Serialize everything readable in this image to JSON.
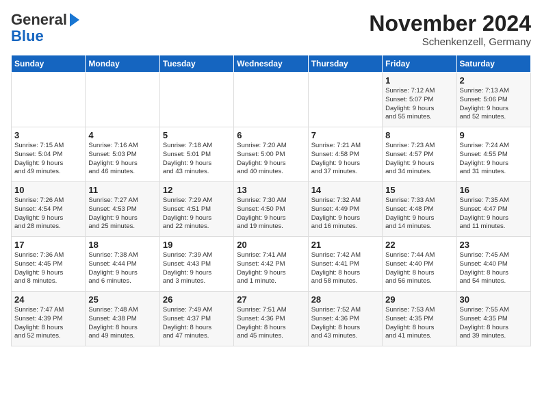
{
  "header": {
    "logo_line1": "General",
    "logo_line2": "Blue",
    "title": "November 2024",
    "subtitle": "Schenkenzell, Germany"
  },
  "weekdays": [
    "Sunday",
    "Monday",
    "Tuesday",
    "Wednesday",
    "Thursday",
    "Friday",
    "Saturday"
  ],
  "weeks": [
    [
      {
        "day": "",
        "info": ""
      },
      {
        "day": "",
        "info": ""
      },
      {
        "day": "",
        "info": ""
      },
      {
        "day": "",
        "info": ""
      },
      {
        "day": "",
        "info": ""
      },
      {
        "day": "1",
        "info": "Sunrise: 7:12 AM\nSunset: 5:07 PM\nDaylight: 9 hours\nand 55 minutes."
      },
      {
        "day": "2",
        "info": "Sunrise: 7:13 AM\nSunset: 5:06 PM\nDaylight: 9 hours\nand 52 minutes."
      }
    ],
    [
      {
        "day": "3",
        "info": "Sunrise: 7:15 AM\nSunset: 5:04 PM\nDaylight: 9 hours\nand 49 minutes."
      },
      {
        "day": "4",
        "info": "Sunrise: 7:16 AM\nSunset: 5:03 PM\nDaylight: 9 hours\nand 46 minutes."
      },
      {
        "day": "5",
        "info": "Sunrise: 7:18 AM\nSunset: 5:01 PM\nDaylight: 9 hours\nand 43 minutes."
      },
      {
        "day": "6",
        "info": "Sunrise: 7:20 AM\nSunset: 5:00 PM\nDaylight: 9 hours\nand 40 minutes."
      },
      {
        "day": "7",
        "info": "Sunrise: 7:21 AM\nSunset: 4:58 PM\nDaylight: 9 hours\nand 37 minutes."
      },
      {
        "day": "8",
        "info": "Sunrise: 7:23 AM\nSunset: 4:57 PM\nDaylight: 9 hours\nand 34 minutes."
      },
      {
        "day": "9",
        "info": "Sunrise: 7:24 AM\nSunset: 4:55 PM\nDaylight: 9 hours\nand 31 minutes."
      }
    ],
    [
      {
        "day": "10",
        "info": "Sunrise: 7:26 AM\nSunset: 4:54 PM\nDaylight: 9 hours\nand 28 minutes."
      },
      {
        "day": "11",
        "info": "Sunrise: 7:27 AM\nSunset: 4:53 PM\nDaylight: 9 hours\nand 25 minutes."
      },
      {
        "day": "12",
        "info": "Sunrise: 7:29 AM\nSunset: 4:51 PM\nDaylight: 9 hours\nand 22 minutes."
      },
      {
        "day": "13",
        "info": "Sunrise: 7:30 AM\nSunset: 4:50 PM\nDaylight: 9 hours\nand 19 minutes."
      },
      {
        "day": "14",
        "info": "Sunrise: 7:32 AM\nSunset: 4:49 PM\nDaylight: 9 hours\nand 16 minutes."
      },
      {
        "day": "15",
        "info": "Sunrise: 7:33 AM\nSunset: 4:48 PM\nDaylight: 9 hours\nand 14 minutes."
      },
      {
        "day": "16",
        "info": "Sunrise: 7:35 AM\nSunset: 4:47 PM\nDaylight: 9 hours\nand 11 minutes."
      }
    ],
    [
      {
        "day": "17",
        "info": "Sunrise: 7:36 AM\nSunset: 4:45 PM\nDaylight: 9 hours\nand 8 minutes."
      },
      {
        "day": "18",
        "info": "Sunrise: 7:38 AM\nSunset: 4:44 PM\nDaylight: 9 hours\nand 6 minutes."
      },
      {
        "day": "19",
        "info": "Sunrise: 7:39 AM\nSunset: 4:43 PM\nDaylight: 9 hours\nand 3 minutes."
      },
      {
        "day": "20",
        "info": "Sunrise: 7:41 AM\nSunset: 4:42 PM\nDaylight: 9 hours\nand 1 minute."
      },
      {
        "day": "21",
        "info": "Sunrise: 7:42 AM\nSunset: 4:41 PM\nDaylight: 8 hours\nand 58 minutes."
      },
      {
        "day": "22",
        "info": "Sunrise: 7:44 AM\nSunset: 4:40 PM\nDaylight: 8 hours\nand 56 minutes."
      },
      {
        "day": "23",
        "info": "Sunrise: 7:45 AM\nSunset: 4:40 PM\nDaylight: 8 hours\nand 54 minutes."
      }
    ],
    [
      {
        "day": "24",
        "info": "Sunrise: 7:47 AM\nSunset: 4:39 PM\nDaylight: 8 hours\nand 52 minutes."
      },
      {
        "day": "25",
        "info": "Sunrise: 7:48 AM\nSunset: 4:38 PM\nDaylight: 8 hours\nand 49 minutes."
      },
      {
        "day": "26",
        "info": "Sunrise: 7:49 AM\nSunset: 4:37 PM\nDaylight: 8 hours\nand 47 minutes."
      },
      {
        "day": "27",
        "info": "Sunrise: 7:51 AM\nSunset: 4:36 PM\nDaylight: 8 hours\nand 45 minutes."
      },
      {
        "day": "28",
        "info": "Sunrise: 7:52 AM\nSunset: 4:36 PM\nDaylight: 8 hours\nand 43 minutes."
      },
      {
        "day": "29",
        "info": "Sunrise: 7:53 AM\nSunset: 4:35 PM\nDaylight: 8 hours\nand 41 minutes."
      },
      {
        "day": "30",
        "info": "Sunrise: 7:55 AM\nSunset: 4:35 PM\nDaylight: 8 hours\nand 39 minutes."
      }
    ]
  ]
}
